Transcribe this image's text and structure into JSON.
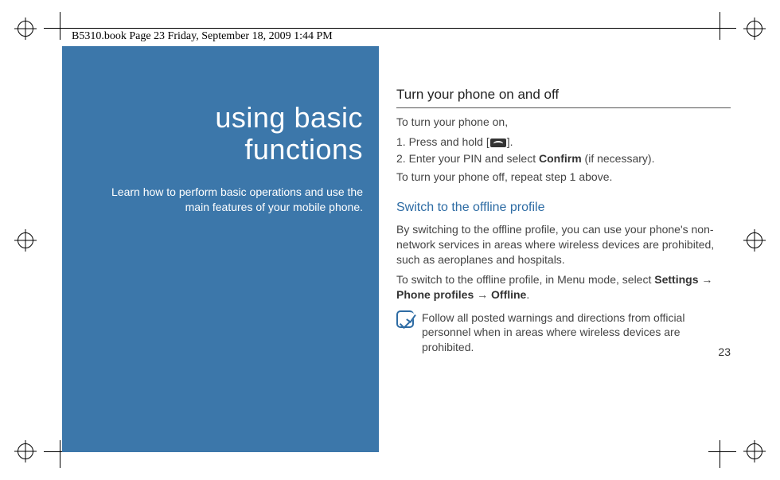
{
  "header": {
    "running_head": "B5310.book  Page 23  Friday, September 18, 2009  1:44 PM"
  },
  "left_panel": {
    "title_line1": "using basic",
    "title_line2": "functions",
    "subtitle_line1": " Learn how to perform basic operations and use the",
    "subtitle_line2": "main features of your mobile phone."
  },
  "content": {
    "section1_heading": "Turn your phone on and off",
    "section1_intro": "To turn your phone on,",
    "step1_prefix": "1.   Press and hold [",
    "step1_suffix": "].",
    "step2_prefix": "2.   Enter your PIN and select ",
    "step2_bold": "Confirm",
    "step2_suffix": " (if necessary).",
    "section1_outro": "To turn your phone off, repeat step 1 above.",
    "section2_heading": "Switch to the offline profile",
    "section2_p1": "By switching to the offline profile, you can use your phone's non-network services in areas where wireless devices are prohibited, such as aeroplanes and hospitals.",
    "section2_p2_prefix": "To switch to the offline profile, in Menu mode, select ",
    "section2_p2_b1": "Settings",
    "section2_p2_arrow1": " → ",
    "section2_p2_b2": "Phone profiles",
    "section2_p2_arrow2": " → ",
    "section2_p2_b3": "Offline",
    "section2_p2_suffix": ".",
    "note_text": "Follow all posted warnings and directions from official personnel when in areas where wireless devices are prohibited."
  },
  "page_number": "23"
}
